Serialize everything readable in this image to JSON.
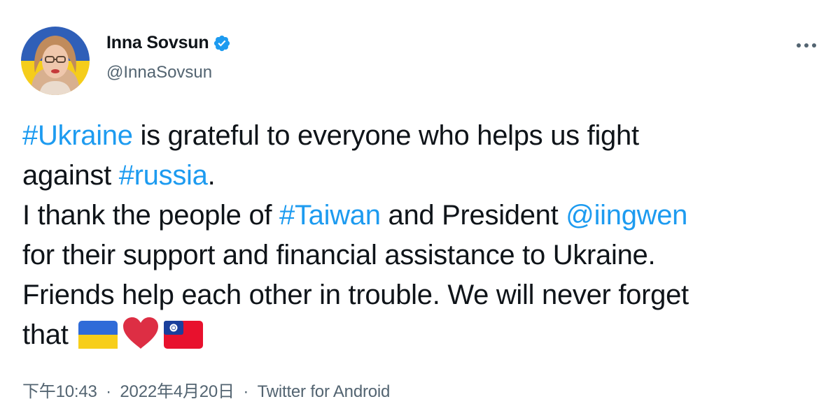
{
  "author": {
    "display_name": "Inna Sovsun",
    "handle": "@InnaSovsun",
    "verified": true
  },
  "tweet": {
    "lines": [
      [
        {
          "text": "#Ukraine",
          "type": "hashtag"
        },
        {
          "text": " is grateful to everyone who helps us fight",
          "type": "text"
        }
      ],
      [
        {
          "text": "against ",
          "type": "text"
        },
        {
          "text": "#russia",
          "type": "hashtag"
        },
        {
          "text": ".",
          "type": "text"
        }
      ],
      [
        {
          "text": "I thank the people of ",
          "type": "text"
        },
        {
          "text": "#Taiwan",
          "type": "hashtag"
        },
        {
          "text": " and President ",
          "type": "text"
        },
        {
          "text": "@iingwen",
          "type": "mention"
        }
      ],
      [
        {
          "text": "for their support and financial assistance to Ukraine.",
          "type": "text"
        }
      ],
      [
        {
          "text": "Friends help each other in trouble. We will never forget",
          "type": "text"
        }
      ],
      [
        {
          "text": "that ",
          "type": "text"
        }
      ]
    ],
    "emojis": [
      "ukraine-flag-icon",
      "red-heart-icon",
      "taiwan-flag-icon"
    ]
  },
  "meta": {
    "time": "下午10:43",
    "separator": "·",
    "date": "2022年4月20日",
    "source": "Twitter for Android"
  },
  "colors": {
    "text": "#0f1419",
    "secondary": "#536471",
    "link": "#1d9bf0",
    "verified": "#1d9bf0",
    "ukraine_blue": "#2f6bd8",
    "ukraine_yellow": "#f7ce1a",
    "heart_red": "#dd2e44",
    "taiwan_red": "#e8112d",
    "taiwan_blue": "#1a3f9c"
  }
}
